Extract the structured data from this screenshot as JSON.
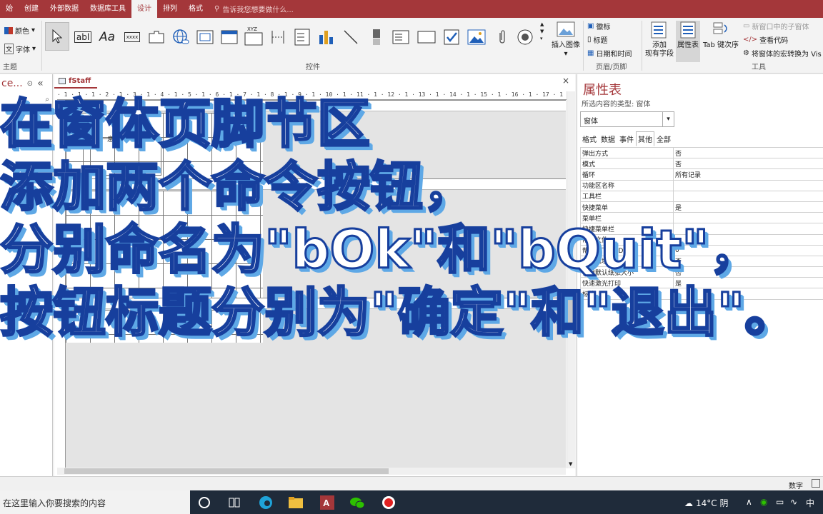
{
  "ribbon": {
    "tabs": [
      "始",
      "创建",
      "外部数据",
      "数据库工具",
      "设计",
      "排列",
      "格式"
    ],
    "active_tab": "设计",
    "tell_me": "告诉我您想要做什么...",
    "theme_group": {
      "colors": "颜色",
      "fonts": "字体",
      "label": "主题"
    },
    "controls_group_label": "控件",
    "controls_text_box_label": "abl",
    "controls_label_glyph": "Aa",
    "controls_button_glyph": "xxxx",
    "controls_xyz_glyph": "XYZ",
    "insert_image": "插入图像",
    "header_footer": {
      "logo": "徽标",
      "title": "标题",
      "date_time": "日期和时间",
      "label": "页眉/页脚"
    },
    "tools": {
      "add_existing_fields": "添加\n现有字段",
      "property_sheet": "属性表",
      "tab_order": "Tab 键次序",
      "subform_new_window": "新窗口中的子窗体",
      "view_code": "查看代码",
      "convert_macros": "将窗体的宏转换为 Vis",
      "label": "工具"
    },
    "accent_color": "#a4373a"
  },
  "nav_pane": {
    "title": "ce...",
    "collapse_glyph": "«"
  },
  "document": {
    "tab_title": "fStaff",
    "close_glyph": "×",
    "ruler_text": "· 1 · 1 · 1 · 2 · 1 · 3 · 1 · 4 · 1 · 5 · 1 · 6 · 1 · 7 · 1 · 8 · 1 · 9 · 1 · 10 · 1 · 11 · 1 · 12 · 1 · 13 · 1 · 14 · 1 · 15 · 1 · 16 · 1 · 17 · 1 · 18 · 1 · 19 · 1 · 20 · 1 · 21 ·",
    "radio_label": "女",
    "small_label": "息"
  },
  "property_sheet": {
    "title": "属性表",
    "subtitle": "所选内容的类型: 窗体",
    "selected_object": "窗体",
    "tabs": [
      "格式",
      "数据",
      "事件",
      "其他",
      "全部"
    ],
    "active_tab": "其他",
    "rows": [
      {
        "key": "弹出方式",
        "value": "否"
      },
      {
        "key": "模式",
        "value": "否"
      },
      {
        "key": "循环",
        "value": "所有记录"
      },
      {
        "key": "功能区名称",
        "value": ""
      },
      {
        "key": "工具栏",
        "value": ""
      },
      {
        "key": "快捷菜单",
        "value": "是"
      },
      {
        "key": "菜单栏",
        "value": ""
      },
      {
        "key": "快捷菜单栏",
        "value": ""
      },
      {
        "key": "帮助文件",
        "value": ""
      },
      {
        "key": "帮助上下文 ID",
        "value": "0"
      },
      {
        "key": "内含模块",
        "value": "否"
      },
      {
        "key": "使用默认纸张大小",
        "value": "否"
      },
      {
        "key": "快速激光打印",
        "value": "是"
      },
      {
        "key": "标签",
        "value": ""
      }
    ]
  },
  "status_bar": {
    "mode": "数字"
  },
  "taskbar": {
    "search_placeholder": "在这里输入你要搜索的内容",
    "weather": "14°C 阴",
    "ime": "中",
    "expand_glyph": "∧"
  },
  "overlay_caption": {
    "lines": [
      "在窗体页脚节区",
      "添加两个命令按钮，",
      "分别命名为\"bOk\"和\"bQuit\"，",
      "按钮标题分别为\"确定\"和\"退出\"。"
    ],
    "fill_color": "#ffffff",
    "stroke_color": "#173f9d",
    "shadow_color": "#5ea8e6"
  }
}
